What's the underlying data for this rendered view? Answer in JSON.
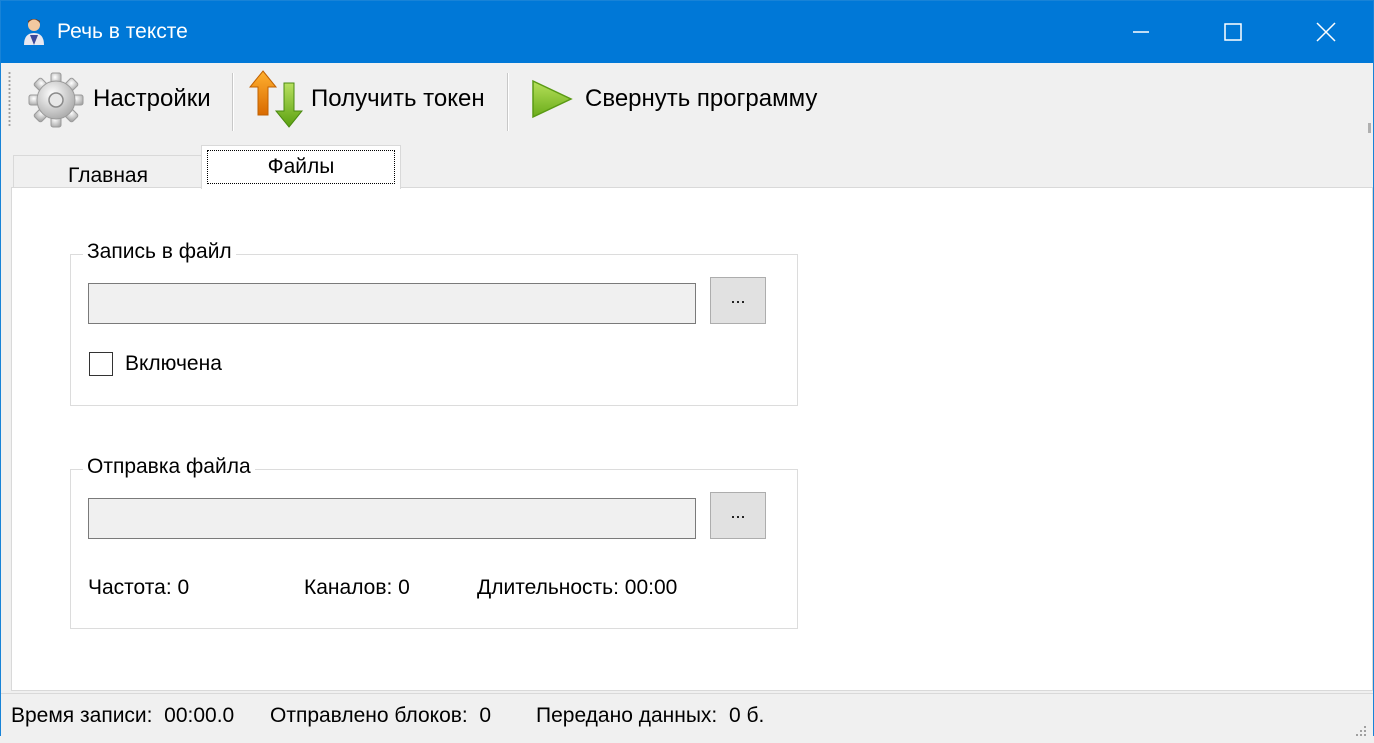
{
  "window": {
    "title": "Речь в тексте"
  },
  "toolbar": {
    "settings_label": "Настройки",
    "token_label": "Получить токен",
    "minimize_label": "Свернуть программу"
  },
  "tabs": {
    "main_label": "Главная",
    "files_label": "Файлы",
    "active": "Файлы"
  },
  "record_group": {
    "legend": "Запись в файл",
    "path_value": "",
    "browse_label": "...",
    "enabled_label": "Включена",
    "enabled_checked": false
  },
  "send_group": {
    "legend": "Отправка файла",
    "path_value": "",
    "browse_label": "...",
    "frequency": "Частота:  0",
    "channels": "Каналов:  0",
    "duration": "Длительность: 00:00"
  },
  "statusbar": {
    "record_time": "Время записи:  00:00.0",
    "blocks_sent": "Отправлено блоков:  0",
    "data_sent": "Передано данных:  0 б."
  },
  "colors": {
    "titlebar": "#0078d7",
    "play_icon": "#8dc63f"
  },
  "icons": {
    "settings": "gear-icon",
    "token": "up-down-arrows-icon",
    "minimize": "play-triangle-icon"
  }
}
